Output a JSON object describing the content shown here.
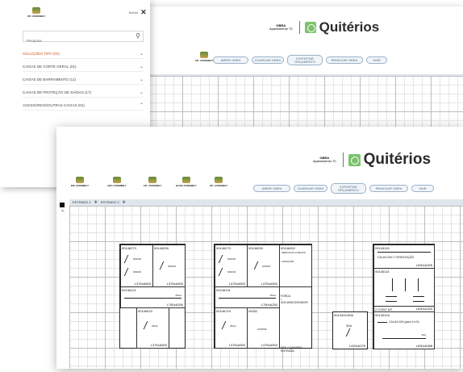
{
  "back_window": {
    "brand": {
      "obra": "OBRA",
      "obra_sub": "Apartamento T2",
      "logo": "Quitérios"
    },
    "toolbar_buttons": [
      "ABRIR OBRA",
      "GUARDAR OBRA",
      "EXPORTAR ORÇAMENTO",
      "REINICIAR OBRA",
      "SAIR"
    ],
    "thumbnails": [
      "ATL ASSEMBLY"
    ]
  },
  "side_panel": {
    "title": "ATL ASSEMBLY",
    "close_label": "fechar",
    "close_icon": "close-icon",
    "search_placeholder": "Pesquisa",
    "categories": [
      {
        "label": "SOLUÇÕES TIPO (03)",
        "active": true
      },
      {
        "label": "CAIXAS DE CORTE GERAL (01)",
        "active": false
      },
      {
        "label": "CAIXAS DE BARRAMENTO (11)",
        "active": false
      },
      {
        "label": "CAIXAS DE PROTEÇÃO DE SAÍDAS (17)",
        "active": false
      },
      {
        "label": "ACESSÓRIOS/OUTRAS CAIXAS (01)",
        "active": false
      }
    ]
  },
  "front_window": {
    "brand": {
      "obra": "OBRA",
      "obra_sub": "Apartamento T2",
      "logo": "Quitérios"
    },
    "toolbar_buttons": [
      "ABRIR OBRA",
      "GUARDAR OBRA",
      "EXPORTAR ORÇAMENTO",
      "REINICIAR OBRA",
      "SAIR"
    ],
    "thumbnails": [
      "RIC ASSEMBLY",
      "GEC ASSEMBLY",
      "ATL ASSEMBLY",
      "BASE ASSEMBLY",
      "ATL ASSEMBLY"
    ],
    "tabs": [
      "ESTRADO 1",
      "ESTRADO 2"
    ],
    "modules": {
      "m1": {
        "cells": [
          {
            "code": "00146273",
            "label": "NIMOD",
            "label2": "NIMOD",
            "dim": "L375xA500"
          },
          {
            "code": "00146255",
            "label": "NIMOD",
            "dim": "L375xA500"
          },
          {
            "code": "00146121",
            "label": "25GA",
            "dim": "L750xA250"
          },
          {
            "code": "00146019",
            "label": "25GA",
            "dim": "L375xA500"
          }
        ]
      },
      "m2": {
        "cells": [
          {
            "code": "00146273",
            "label": "NIMOD",
            "label2": "NIMOD",
            "dim": "L375xA500"
          },
          {
            "code": "00146255",
            "label": "NIMOD",
            "dim": "L375xA500"
          },
          {
            "code": "00146452",
            "label": "SERVIÇOS COMUNS",
            "dim": "L400xA250",
            "side": "FORÇA / SOCIAIS"
          },
          {
            "code": "00146131",
            "label": "25GA",
            "dim": "L750xA250",
            "side": "CONTADOR"
          },
          {
            "code": "00146719",
            "label": "25GA",
            "dim": "L375xA500"
          },
          {
            "code": "00032",
            "label": "IVISTRE",
            "dim": "L375xA500",
            "side": "DEF + QUADRO ENTRADA"
          }
        ]
      },
      "m3": {
        "code": "00143GU306",
        "label": "30A",
        "dim": "L420xA375"
      },
      "m4": {
        "cells": [
          {
            "code": "00145100",
            "label": "CALHA DIN 7 ORIENTAÇÃO",
            "dim": "L630xA255"
          },
          {
            "code": "00145114",
            "label": "",
            "dim": ""
          },
          {
            "code": "2 CONT MT",
            "label": "",
            "dim": "L630xA333"
          },
          {
            "code": "00145104",
            "label": "CALHA DIN (para 4 e 8)",
            "label2": "30A",
            "dim": "L630xA388"
          }
        ]
      }
    }
  }
}
